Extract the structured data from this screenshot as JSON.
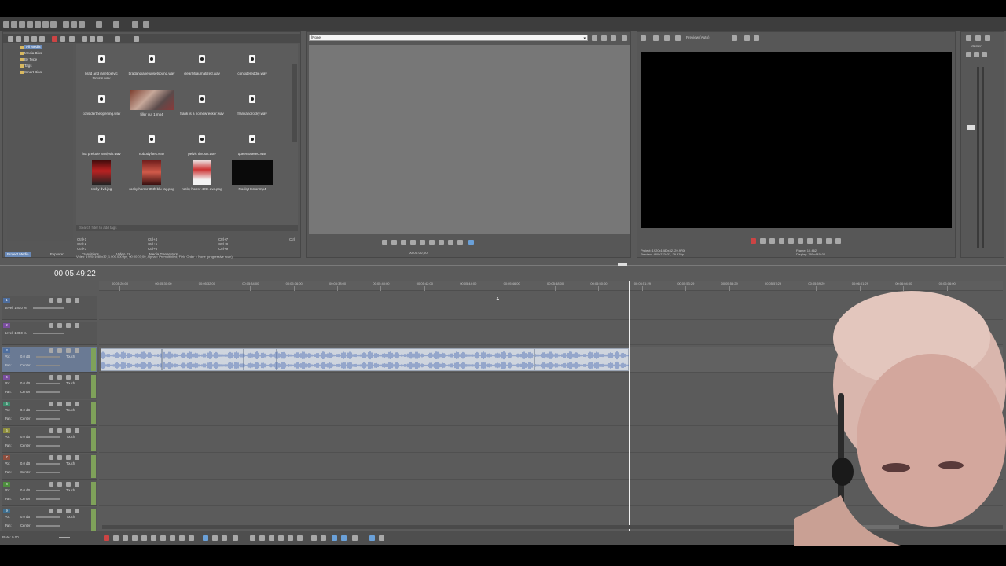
{
  "app": {
    "accent": "#6a8ab8",
    "media_panel": {
      "tree": [
        {
          "label": "All Media",
          "selected": true
        },
        {
          "label": "Media Bins",
          "selected": false
        },
        {
          "label": "By Type",
          "selected": false
        },
        {
          "label": "Tags",
          "selected": false
        },
        {
          "label": "Smart Bins",
          "selected": false
        }
      ],
      "items": [
        {
          "label": "brad and janet pelvic thrusts.wav",
          "kind": "audio"
        },
        {
          "label": "bradandjanetupsetsound.wav",
          "kind": "audio"
        },
        {
          "label": "clearlytraumatized.wav",
          "kind": "audio"
        },
        {
          "label": "considereddie.wav",
          "kind": "audio"
        },
        {
          "label": "considertheopening.wav",
          "kind": "audio"
        },
        {
          "label": "filler cut 1.mp4",
          "kind": "video"
        },
        {
          "label": "frank is a homewrecker.wav",
          "kind": "audio"
        },
        {
          "label": "frankandrocky.wav",
          "kind": "audio"
        },
        {
          "label": "hot prelude analysis.wav",
          "kind": "audio"
        },
        {
          "label": "nobodyfites.wav",
          "kind": "audio"
        },
        {
          "label": "pelvic thrusts.wav",
          "kind": "audio"
        },
        {
          "label": "queerrottered.wav",
          "kind": "audio"
        },
        {
          "label": "rocky dvd.jpg",
          "kind": "poster"
        },
        {
          "label": "rocky horror 35th blu ray.png",
          "kind": "poster2"
        },
        {
          "label": "rocky horror 40th dvd.png",
          "kind": "poster3"
        },
        {
          "label": "RockyHorror.mp4",
          "kind": "black"
        }
      ],
      "search_placeholder": "Search filter to add tags",
      "shortcuts": [
        "Ctrl+1",
        "Ctrl+2",
        "Ctrl+3",
        "Ctrl+4",
        "Ctrl+5",
        "Ctrl+6",
        "Ctrl+7",
        "Ctrl+8",
        "Ctrl+9",
        "Ctrl"
      ],
      "info_line": "Video: 1920x1080x32, 1.000.000 fps, 00:00:03;00, Alpha = Premultiplied, Field Order = None (progressive scan)",
      "tabs": [
        "Project Media",
        "Explorer",
        "Transitions",
        "Video FX",
        "Media Generators"
      ]
    },
    "trimmer": {
      "dropdown_value": "[None]",
      "timecode": "00:00:00;00"
    },
    "preview": {
      "mode_label": "Preview (Auto)",
      "project_line": "Project: 1920x1080x32, 29.970i",
      "preview_line": "Preview: 480x270x32, 29.970p",
      "frame_line": "Frame: 10,462",
      "display_line": "Display: 791x445x32"
    },
    "master": {
      "label": "Master"
    },
    "timeline": {
      "timecode": "00:05:49;22",
      "ruler_ticks": [
        "00:05:26;00",
        "00:05:30;00",
        "00:05:32;00",
        "00:05:34;00",
        "00:05:36;00",
        "00:05:38;00",
        "00:05:40;00",
        "00:05:42;00",
        "00:05:44;00",
        "00:05:46;00",
        "00:05:48;00",
        "00:05:50;00",
        "00:05:51;29",
        "00:05:53;29",
        "00:05:55;29",
        "00:05:57;29",
        "00:05:59;29",
        "00:06:01;29",
        "00:06:04;00",
        "00:06:06;00"
      ],
      "video_tracks": [
        {
          "num": "1",
          "level": "Level: 100.0 %",
          "color": "#4e6e9e"
        },
        {
          "num": "2",
          "level": "Level: 100.0 %",
          "color": "#7a4e9e"
        }
      ],
      "audio_tracks": [
        {
          "num": "3",
          "vol": "Vol:",
          "vol_val": "0.0 dB",
          "pan": "Pan:",
          "pan_val": "Center",
          "mode": "Touch",
          "color": "#4e6e9e"
        },
        {
          "num": "4",
          "vol": "Vol:",
          "vol_val": "0.0 dB",
          "pan": "Pan:",
          "pan_val": "Center",
          "mode": "Touch",
          "color": "#7a4e9e"
        },
        {
          "num": "5",
          "vol": "Vol:",
          "vol_val": "0.0 dB",
          "pan": "Pan:",
          "pan_val": "Center",
          "mode": "Touch",
          "color": "#3e8e6e"
        },
        {
          "num": "6",
          "vol": "Vol:",
          "vol_val": "0.0 dB",
          "pan": "Pan:",
          "pan_val": "Center",
          "mode": "Touch",
          "color": "#8e8e3e"
        },
        {
          "num": "7",
          "vol": "Vol:",
          "vol_val": "0.0 dB",
          "pan": "Pan:",
          "pan_val": "Center",
          "mode": "Touch",
          "color": "#8e4e3e"
        },
        {
          "num": "8",
          "vol": "Vol:",
          "vol_val": "0.0 dB",
          "pan": "Pan:",
          "pan_val": "Center",
          "mode": "Touch",
          "color": "#4e8e3e"
        },
        {
          "num": "9",
          "vol": "Vol:",
          "vol_val": "0.0 dB",
          "pan": "Pan:",
          "pan_val": "Center",
          "mode": "Touch",
          "color": "#3e6e8e"
        }
      ],
      "rate_label": "Rate: 0.00"
    }
  }
}
